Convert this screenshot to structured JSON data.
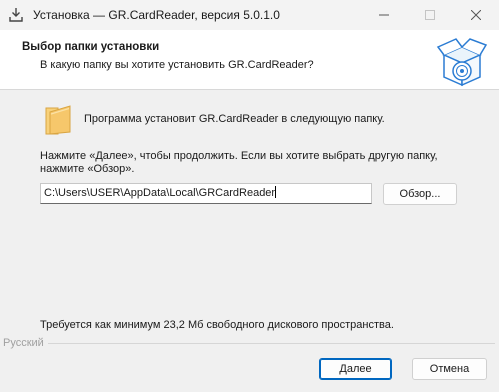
{
  "window": {
    "title": "Установка — GR.CardReader, версия 5.0.1.0",
    "min_icon": "minimize-icon",
    "max_icon": "maximize-icon",
    "close_icon": "close-icon"
  },
  "header": {
    "title": "Выбор папки установки",
    "subtitle": "В какую папку вы хотите установить GR.CardReader?",
    "icon": "installer-box-icon"
  },
  "content": {
    "intro": "Программа установит GR.CardReader в следующую папку.",
    "instruction_line1": "Нажмите «Далее», чтобы продолжить. Если вы хотите выбрать другую папку,",
    "instruction_line2": "нажмите «Обзор».",
    "path_value": "C:\\Users\\USER\\AppData\\Local\\GRCardReader",
    "browse_label": "Обзор...",
    "space_required": "Требуется как минимум 23,2 Мб свободного дискового пространства."
  },
  "footer": {
    "language": "Русский",
    "next_label": "Далее",
    "cancel_label": "Отмена"
  },
  "colors": {
    "accent": "#0067c0",
    "folder": "#f6c76b",
    "background": "#f0f0f0"
  }
}
